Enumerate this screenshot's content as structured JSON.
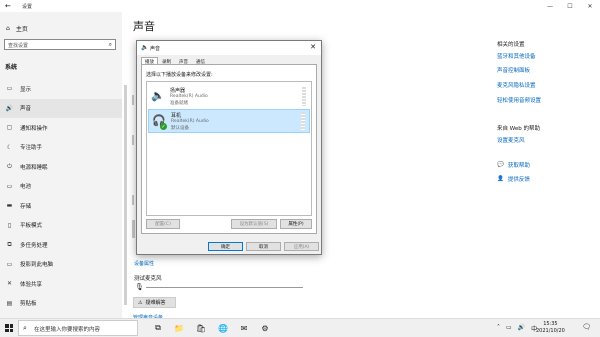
{
  "window": {
    "title": "设置",
    "controls": [
      "—",
      "☐",
      "✕"
    ]
  },
  "sidebar": {
    "home": "主页",
    "search_placeholder": "查找设置",
    "section": "系统",
    "items": [
      {
        "icon": "display-icon",
        "glyph": "▭",
        "label": "显示"
      },
      {
        "icon": "sound-icon",
        "glyph": "🔊",
        "label": "声音"
      },
      {
        "icon": "notifications-icon",
        "glyph": "▢",
        "label": "通知和操作"
      },
      {
        "icon": "focus-assist-icon",
        "glyph": "☾",
        "label": "专注助手"
      },
      {
        "icon": "power-sleep-icon",
        "glyph": "⏻",
        "label": "电源和睡眠"
      },
      {
        "icon": "battery-icon",
        "glyph": "▭",
        "label": "电池"
      },
      {
        "icon": "storage-icon",
        "glyph": "▬",
        "label": "存储"
      },
      {
        "icon": "tablet-icon",
        "glyph": "▯",
        "label": "平板模式"
      },
      {
        "icon": "multitasking-icon",
        "glyph": "⧉",
        "label": "多任务处理"
      },
      {
        "icon": "projecting-icon",
        "glyph": "▭",
        "label": "投影到此电脑"
      },
      {
        "icon": "shared-experiences-icon",
        "glyph": "✕",
        "label": "体验共享"
      },
      {
        "icon": "clipboard-icon",
        "glyph": "▤",
        "label": "剪贴板"
      },
      {
        "icon": "remote-desktop-icon",
        "glyph": "✕",
        "label": "远程桌面"
      }
    ]
  },
  "main": {
    "title": "声音",
    "device_properties_link": "设备属性",
    "test_mic_label": "测试麦克风",
    "troubleshoot_button": "疑难解答",
    "manage_devices_link": "管理声音设备"
  },
  "right": {
    "related_heading": "相关的设置",
    "related_links": [
      "蓝牙和其他设备",
      "声音控制面板",
      "麦克风隐私设置",
      "轻松使用音频设置"
    ],
    "help_heading": "来自 Web 的帮助",
    "help_links": [
      "设置麦克风"
    ],
    "get_help": "获取帮助",
    "feedback": "提供反馈"
  },
  "dialog": {
    "title": "声音",
    "tabs": [
      "播放",
      "录制",
      "声音",
      "通信"
    ],
    "instruction": "选择以下播放设备来修改设置:",
    "devices": [
      {
        "name": "扬声器",
        "driver": "Realtek(R) Audio",
        "status": "准备就绪",
        "icon": "speaker-icon",
        "selected": false
      },
      {
        "name": "耳机",
        "driver": "Realtek(R) Audio",
        "status": "默认设备",
        "icon": "headphones-icon",
        "selected": true
      }
    ],
    "configure_button": "配置(C)",
    "set_default_button": "设为默认值(S)",
    "properties_button": "属性(P)",
    "ok_button": "确定",
    "cancel_button": "取消",
    "apply_button": "应用(A)"
  },
  "taskbar": {
    "search_placeholder": "在这里输入你要搜索的内容",
    "time": "15:35",
    "date": "2021/10/20"
  }
}
